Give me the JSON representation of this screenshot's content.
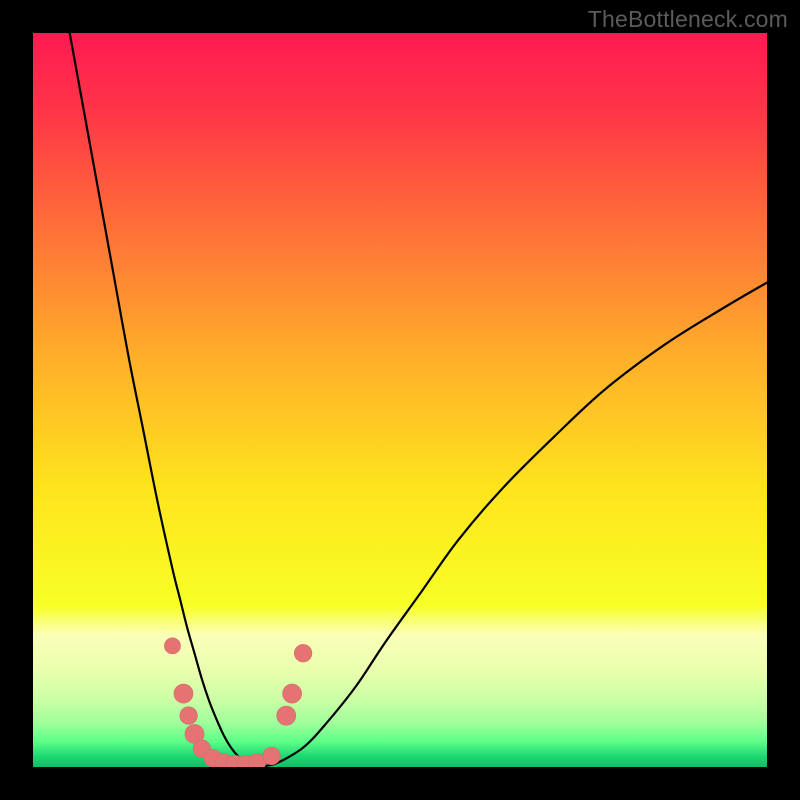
{
  "watermark": "TheBottleneck.com",
  "colors": {
    "frame": "#000000",
    "curve": "#000000",
    "marker_fill": "#e57373",
    "marker_stroke": "#d46a6a",
    "gradient_stops": [
      {
        "offset": 0.0,
        "color": "#ff1a52"
      },
      {
        "offset": 0.1,
        "color": "#ff3348"
      },
      {
        "offset": 0.25,
        "color": "#ff6a3a"
      },
      {
        "offset": 0.45,
        "color": "#ffb129"
      },
      {
        "offset": 0.62,
        "color": "#ffe41d"
      },
      {
        "offset": 0.78,
        "color": "#f7ff26"
      },
      {
        "offset": 0.82,
        "color": "#fbffb8"
      },
      {
        "offset": 0.87,
        "color": "#e9ffad"
      },
      {
        "offset": 0.91,
        "color": "#c9ffa5"
      },
      {
        "offset": 0.94,
        "color": "#9fff9b"
      },
      {
        "offset": 0.965,
        "color": "#5eff88"
      },
      {
        "offset": 0.985,
        "color": "#1fd873"
      },
      {
        "offset": 1.0,
        "color": "#0fbf66"
      }
    ]
  },
  "chart_data": {
    "type": "line",
    "title": "",
    "xlabel": "",
    "ylabel": "",
    "xlim": [
      0,
      100
    ],
    "ylim": [
      0,
      100
    ],
    "y_inverted_color_scale": "red-high green-low",
    "series": [
      {
        "name": "bottleneck-curve",
        "x": [
          5,
          7,
          9,
          11,
          13,
          15,
          17,
          19,
          20,
          21,
          22,
          23,
          24,
          25,
          26,
          27,
          28,
          29,
          30,
          32,
          34,
          37,
          40,
          44,
          48,
          53,
          58,
          64,
          71,
          78,
          86,
          94,
          100
        ],
        "y": [
          100,
          89,
          78,
          67,
          56,
          46,
          36,
          27,
          23,
          19,
          15.5,
          12,
          9,
          6.5,
          4.3,
          2.6,
          1.4,
          0.6,
          0.2,
          0.2,
          0.9,
          2.8,
          6,
          11,
          17,
          24,
          31,
          38,
          45,
          51.5,
          57.5,
          62.5,
          66
        ]
      }
    ],
    "markers": [
      {
        "x": 19.0,
        "y": 16.5,
        "r": 1.1
      },
      {
        "x": 20.5,
        "y": 10.0,
        "r": 1.3
      },
      {
        "x": 21.2,
        "y": 7.0,
        "r": 1.2
      },
      {
        "x": 22.0,
        "y": 4.5,
        "r": 1.3
      },
      {
        "x": 23.0,
        "y": 2.5,
        "r": 1.2
      },
      {
        "x": 24.5,
        "y": 1.2,
        "r": 1.2
      },
      {
        "x": 26.0,
        "y": 0.6,
        "r": 1.2
      },
      {
        "x": 27.5,
        "y": 0.4,
        "r": 1.2
      },
      {
        "x": 29.0,
        "y": 0.4,
        "r": 1.2
      },
      {
        "x": 30.5,
        "y": 0.6,
        "r": 1.2
      },
      {
        "x": 32.5,
        "y": 1.5,
        "r": 1.2
      },
      {
        "x": 34.5,
        "y": 7.0,
        "r": 1.3
      },
      {
        "x": 35.3,
        "y": 10.0,
        "r": 1.3
      },
      {
        "x": 36.8,
        "y": 15.5,
        "r": 1.2
      }
    ]
  }
}
